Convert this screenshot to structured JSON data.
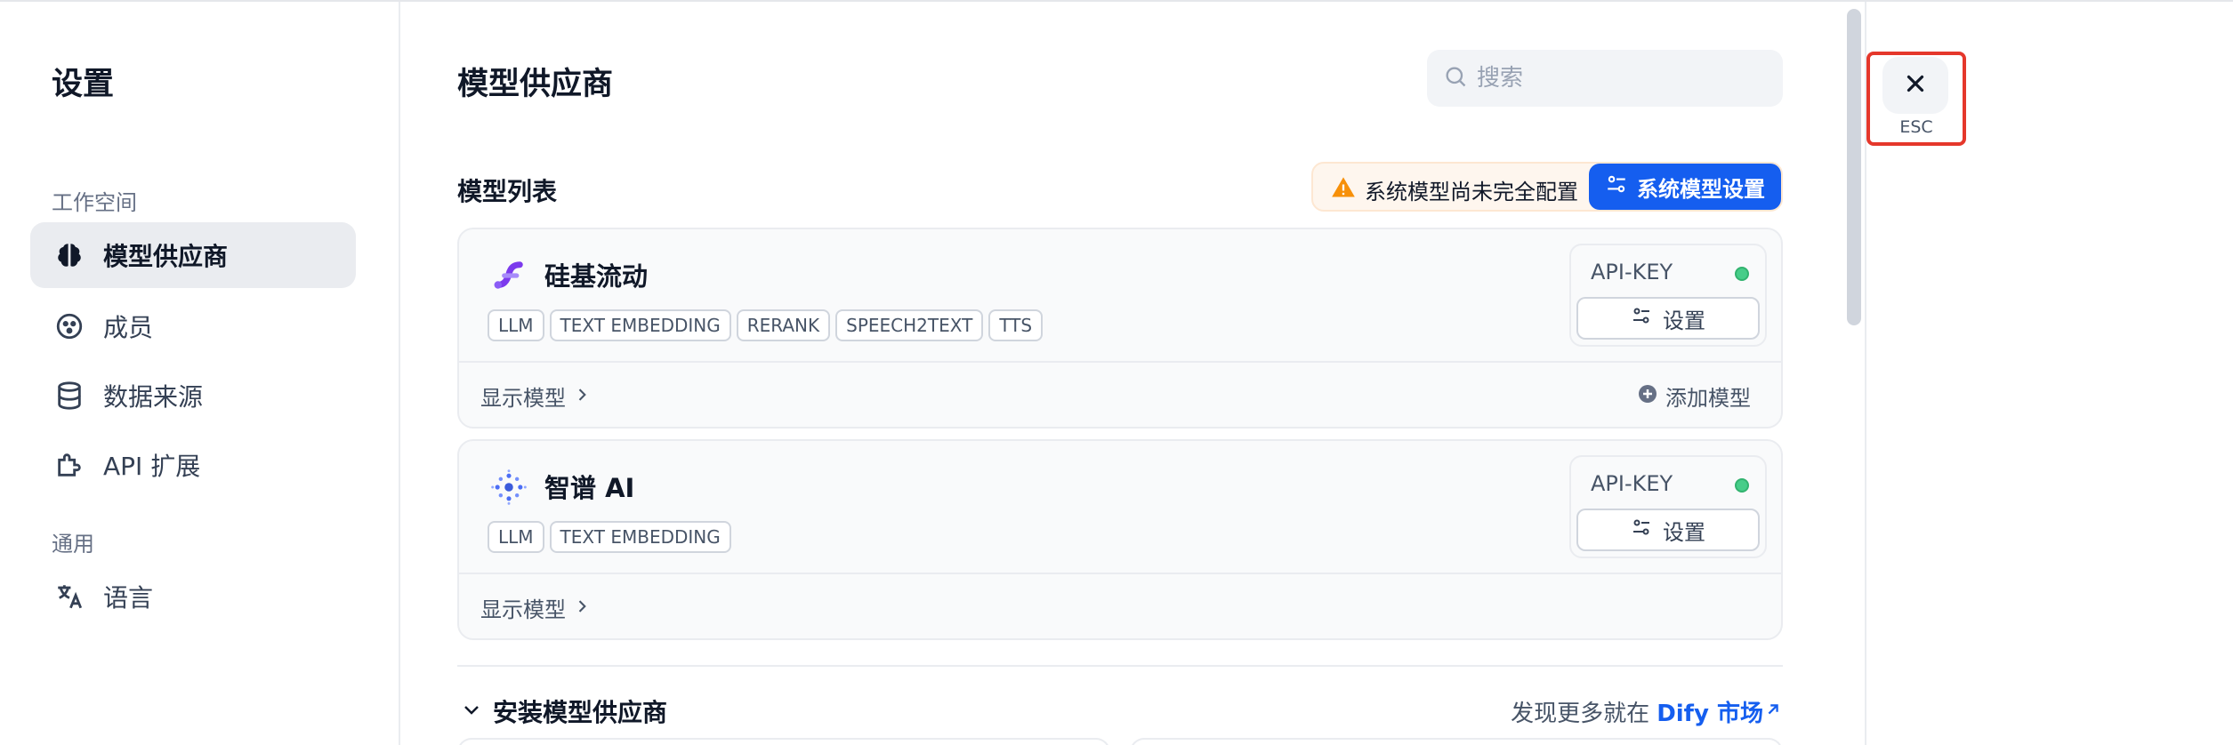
{
  "sidebar": {
    "title": "设置",
    "section_workspace": "工作空间",
    "section_general": "通用",
    "items": [
      {
        "label": "模型供应商",
        "icon": "brain-icon",
        "active": true
      },
      {
        "label": "成员",
        "icon": "members-icon",
        "active": false
      },
      {
        "label": "数据来源",
        "icon": "database-icon",
        "active": false
      },
      {
        "label": "API 扩展",
        "icon": "puzzle-icon",
        "active": false
      },
      {
        "label": "语言",
        "icon": "translate-icon",
        "active": false
      }
    ]
  },
  "main": {
    "title": "模型供应商",
    "search": {
      "placeholder": "搜索",
      "value": ""
    },
    "list_title": "模型列表",
    "warning": "系统模型尚未完全配置",
    "system_settings_button": "系统模型设置",
    "providers": [
      {
        "name": "硅基流动",
        "icon": "siliconflow-logo-icon",
        "tags": [
          "LLM",
          "TEXT EMBEDDING",
          "RERANK",
          "SPEECH2TEXT",
          "TTS"
        ],
        "key_label": "API-KEY",
        "key_status_color": "#47cd89",
        "settings_button": "设置",
        "show_models": "显示模型",
        "add_model": "添加模型"
      },
      {
        "name": "智谱 AI",
        "icon": "zhipu-logo-icon",
        "tags": [
          "LLM",
          "TEXT EMBEDDING"
        ],
        "key_label": "API-KEY",
        "key_status_color": "#47cd89",
        "settings_button": "设置",
        "show_models": "显示模型"
      }
    ],
    "install_title": "安装模型供应商",
    "market_prefix": "发现更多就在",
    "market_link": "Dify 市场"
  },
  "close": {
    "label": "ESC"
  },
  "colors": {
    "accent": "#155eef",
    "warning": "#f79009",
    "highlight_box": "#e5372b"
  }
}
